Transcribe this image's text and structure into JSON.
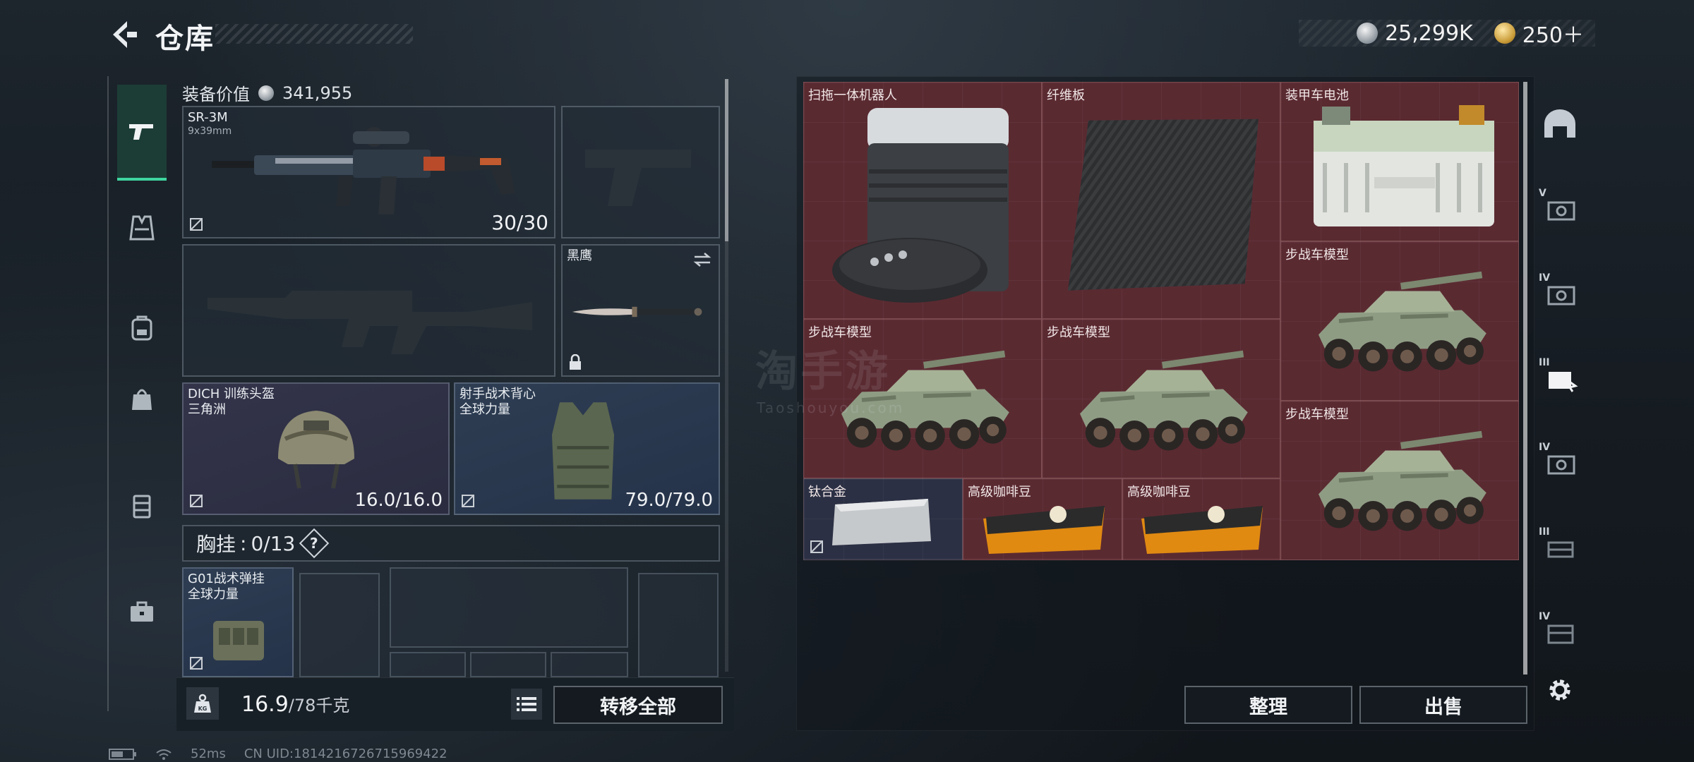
{
  "header": {
    "back_icon": "back-arrow-icon",
    "title": "仓库",
    "currencies": [
      {
        "icon": "silver-coin-icon",
        "amount": "25,299K"
      },
      {
        "icon": "gold-coin-icon",
        "amount": "250＋"
      }
    ]
  },
  "left_rail": {
    "items": [
      {
        "icon": "pistol-icon",
        "active": true
      },
      {
        "icon": "vest-icon"
      },
      {
        "icon": "backpack-icon"
      },
      {
        "icon": "bag-icon"
      },
      {
        "icon": "container-icon"
      },
      {
        "icon": "briefcase-icon"
      }
    ]
  },
  "equipment": {
    "value_label": "装备价值",
    "value": "341,955",
    "primary_weapon": {
      "name": "SR-3M",
      "caliber": "9x39mm",
      "ammo": "30/30"
    },
    "melee": {
      "name": "黑鹰"
    },
    "helmet": {
      "name": "DICH 训练头盔",
      "faction": "三角洲",
      "durability": "16.0/16.0"
    },
    "armor": {
      "name": "射手战术背心",
      "faction": "全球力量",
      "durability": "79.0/79.0"
    },
    "rig": {
      "label": "胸挂",
      "value": "0/13",
      "help": "?"
    },
    "rig_item": {
      "name": "G01战术弹挂",
      "faction": "全球力量"
    },
    "weight": {
      "current": "16.9",
      "max": "/78千克",
      "icon": "weight-icon"
    },
    "list_icon": "list-icon",
    "transfer_label": "转移全部"
  },
  "storage": {
    "items": [
      {
        "name": "扫拖一体机器人"
      },
      {
        "name": "纤维板"
      },
      {
        "name": "装甲车电池"
      },
      {
        "name": "步战车模型"
      },
      {
        "name": "步战车模型"
      },
      {
        "name": "步战车模型"
      },
      {
        "name": "步战车模型"
      },
      {
        "name": "钛合金"
      },
      {
        "name": "高级咖啡豆"
      },
      {
        "name": "高级咖啡豆"
      }
    ],
    "sort_label": "整理",
    "sell_label": "出售"
  },
  "right_rail": {
    "items": [
      {
        "icon": "hideout-icon",
        "tier": ""
      },
      {
        "icon": "storage-v-icon",
        "tier": "V"
      },
      {
        "icon": "storage-iv-icon",
        "tier": "IV"
      },
      {
        "icon": "storage-iii-icon",
        "tier": "III"
      },
      {
        "icon": "storage-iv-b-icon",
        "tier": "IV"
      },
      {
        "icon": "storage-iii-b-icon",
        "tier": "III"
      },
      {
        "icon": "storage-iv-c-icon",
        "tier": "IV"
      },
      {
        "icon": "settings-gear-icon",
        "tier": ""
      }
    ]
  },
  "watermark": {
    "main": "淘手游",
    "sub": "Taoshouyou.com"
  },
  "status": {
    "ping": "52ms",
    "uid": "CN UID:1814216726715969422"
  },
  "colors": {
    "accent": "#3fd6a0",
    "storage_cell": "#5a2a31",
    "blue_slot": "#2e3d52"
  }
}
